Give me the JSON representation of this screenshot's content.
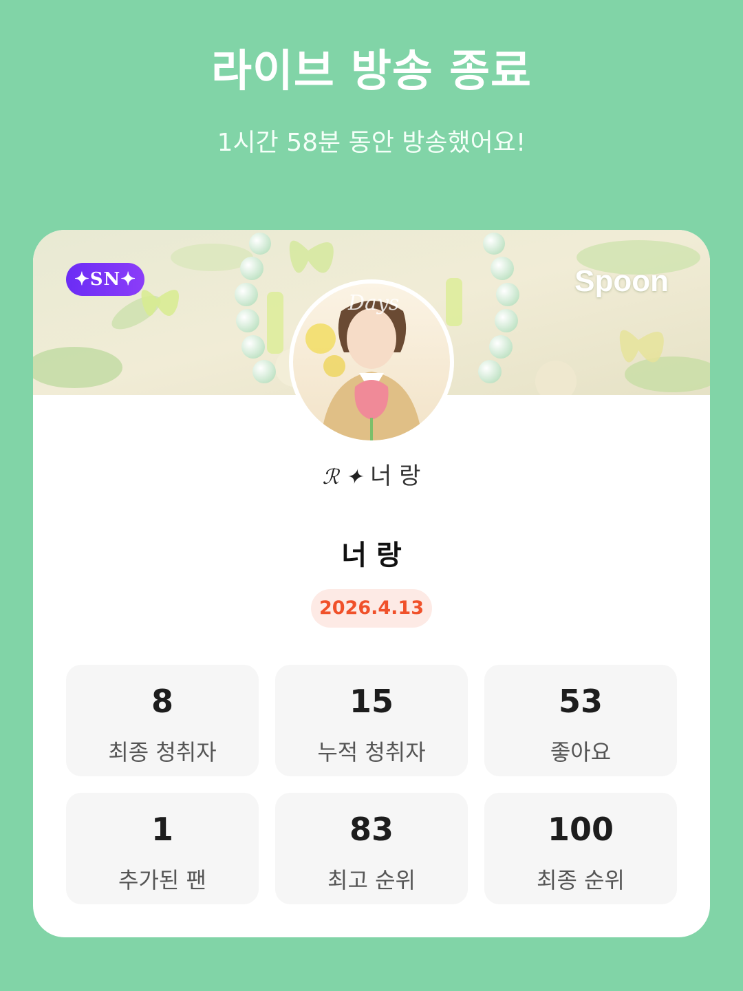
{
  "header": {
    "title": "라이브 방송 종료",
    "subtitle": "1시간 58분 동안 방송했어요!"
  },
  "card": {
    "tier_badge": "✦SN✦",
    "brand": "Spoon",
    "avatar_icon": "dj-profile-image",
    "nickname_deco": "ℛ ✦",
    "nickname_small": "너 랑",
    "nickname_main": "너 랑",
    "date": "2026.4.13",
    "accent_color": "#f0512a"
  },
  "stats": [
    {
      "value": "8",
      "label": "최종 청취자"
    },
    {
      "value": "15",
      "label": "누적 청취자"
    },
    {
      "value": "53",
      "label": "좋아요"
    },
    {
      "value": "1",
      "label": "추가된 팬"
    },
    {
      "value": "83",
      "label": "최고 순위"
    },
    {
      "value": "100",
      "label": "최종 순위"
    }
  ]
}
